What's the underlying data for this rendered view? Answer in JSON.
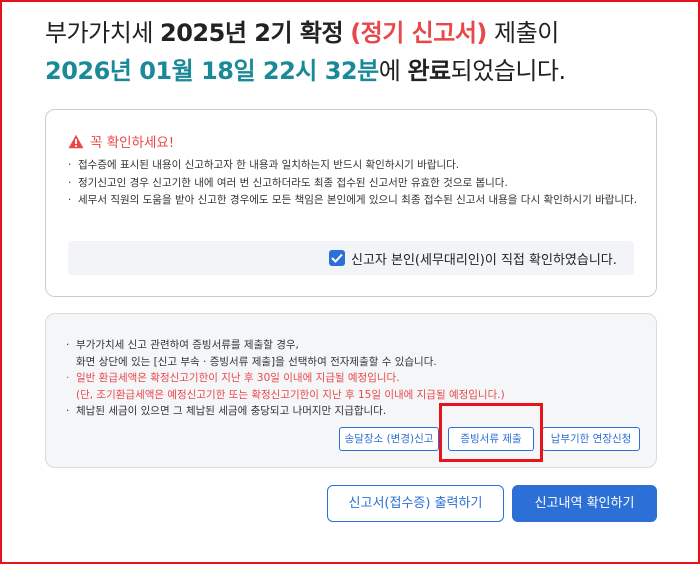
{
  "headline": {
    "line1_prefix": "부가가치세 ",
    "line1_bold": "2025년 2기 확정",
    "line1_red": "(정기 신고서)",
    "line1_suffix": " 제출이",
    "line2_datetime": "2026년 01월 18일 22시 32분",
    "line2_mid": "에 ",
    "line2_bold": "완료",
    "line2_suffix": "되었습니다."
  },
  "notice": {
    "icon": "warning-triangle-icon",
    "title": "꼭 확인하세요!",
    "items": [
      "접수증에 표시된 내용이 신고하고자 한 내용과 일치하는지 반드시 확인하시기 바랍니다.",
      "정기신고인 경우 신고기한 내에 여러 번 신고하더라도 최종 접수된 신고서만 유효한 것으로 봅니다.",
      "세무서 직원의 도움을 받아 신고한 경우에도 모든 책임은 본인에게 있으니 최종 접수된 신고서 내용을 다시 확인하시기 바랍니다."
    ],
    "confirm_label": "신고자 본인(세무대리인)이 직접 확인하였습니다.",
    "confirm_checked": true
  },
  "info": {
    "line1": "부가가치세 신고 관련하여 증빙서류를 제출할 경우,",
    "line2": "화면 상단에 있는 [신고 부속 · 증빙서류 제출]을 선택하여 전자제출할 수 있습니다.",
    "refund_line1": "일반 환급세액은 확정신고기한이 지난 후 30일 이내에 지급될 예정입니다.",
    "refund_line2": "(단, 조기환급세액은 예정신고기한 또는 확정신고기한이 지난 후 15일 이내에 지급될 예정입니다.)",
    "line3": "체납된 세금이 있으면 그 체납된 세금에 충당되고 나머지만 지급합니다.",
    "buttons": {
      "address": "송달장소 (변경)신고",
      "evidence": "증빙서류 제출",
      "extend": "납부기한 연장신청"
    }
  },
  "actions": {
    "print": "신고서(접수증) 출력하기",
    "history": "신고내역 확인하기"
  },
  "colors": {
    "accent_blue": "#2c6fd6",
    "teal": "#1a8a99",
    "alert_red": "#e8484a",
    "highlight_red": "#e8141b"
  }
}
